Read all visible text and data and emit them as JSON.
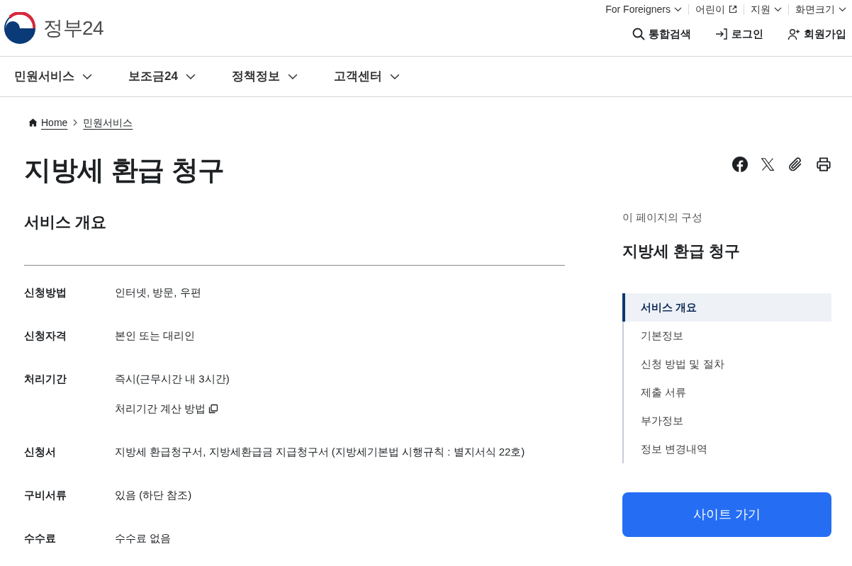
{
  "header": {
    "logo_text": "정부24",
    "utility_links": [
      {
        "label": "For Foreigners",
        "kind": "dropdown"
      },
      {
        "label": "어린이",
        "kind": "external"
      },
      {
        "label": "지원",
        "kind": "dropdown"
      },
      {
        "label": "화면크기",
        "kind": "dropdown"
      }
    ],
    "actions": [
      {
        "label": "통합검색",
        "kind": "search"
      },
      {
        "label": "로그인",
        "kind": "login"
      },
      {
        "label": "회원가입",
        "kind": "signup"
      }
    ]
  },
  "nav": {
    "items": [
      "민원서비스",
      "보조금24",
      "정책정보",
      "고객센터"
    ]
  },
  "breadcrumb": [
    {
      "label": "Home",
      "kind": "home"
    },
    {
      "label": "민원서비스",
      "kind": "page"
    }
  ],
  "page_title": "지방세 환급 청구",
  "overview": {
    "title": "서비스 개요",
    "rows": [
      {
        "label": "신청방법",
        "value": "인터넷, 방문, 우편"
      },
      {
        "label": "신청자격",
        "value": "본인 또는 대리인"
      },
      {
        "label": "처리기간",
        "value": "즉시(근무시간 내 3시간)",
        "link": "처리기간 계산 방법"
      },
      {
        "label": "신청서",
        "value": "지방세 환급청구서, 지방세환급금 지급청구서 (지방세기본법 시행규칙 : 별지서식 22호)"
      },
      {
        "label": "구비서류",
        "value": "있음 (하단 참조)"
      },
      {
        "label": "수수료",
        "value": "수수료 없음"
      }
    ]
  },
  "toc": {
    "caption": "이 페이지의 구성",
    "title": "지방세 환급 청구",
    "items": [
      {
        "label": "서비스 개요",
        "selected": true
      },
      {
        "label": "기본정보",
        "selected": false
      },
      {
        "label": "신청 방법 및 절차",
        "selected": false
      },
      {
        "label": "제출 서류",
        "selected": false
      },
      {
        "label": "부가정보",
        "selected": false
      },
      {
        "label": "정보 변경내역",
        "selected": false
      }
    ]
  },
  "site_button": {
    "label": "사이트 가기"
  }
}
